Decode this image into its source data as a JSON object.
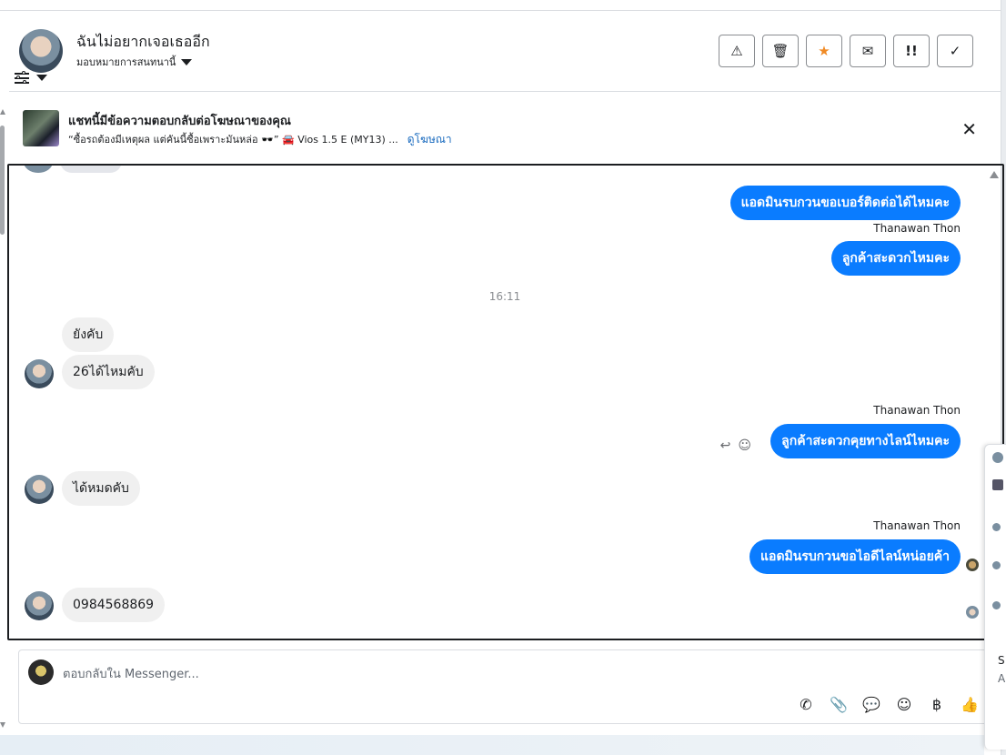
{
  "header": {
    "contact_name": "ฉันไม่อยากเจอเธออีก",
    "assign_label": "มอบหมายการสนทนานี้",
    "actions": [
      {
        "name": "report-spam-button",
        "icon": "warning-icon",
        "glyph": "⚠"
      },
      {
        "name": "delete-button",
        "icon": "trash-icon",
        "glyph": "🗑"
      },
      {
        "name": "star-button",
        "icon": "star-icon",
        "glyph": "★"
      },
      {
        "name": "mark-unread-button",
        "icon": "envelope-open-icon",
        "glyph": "✉"
      },
      {
        "name": "follow-up-button",
        "icon": "exclamation-icon",
        "glyph": "!!"
      },
      {
        "name": "mark-done-button",
        "icon": "check-icon",
        "glyph": "✓"
      }
    ]
  },
  "ad_banner": {
    "title": "แชทนี้มีข้อความตอบกลับต่อโฆษณาของคุณ",
    "subtitle": "“ซื้อรถต้องมีเหตุผล แต่คันนี้ซื้อเพราะมันหล่อ 🕶️” 🚘 Vios 1.5 E (MY13) ...",
    "link": "ดูโฆษณา",
    "close_glyph": "✕"
  },
  "messages": {
    "m1": "แอดมินรบกวนขอเบอร์ติดต่อได้ไหมคะ",
    "sender1": "Thanawan Thon",
    "m2": "ลูกค้าสะดวกไหมคะ",
    "time1": "16:11",
    "m3": "ยังคับ",
    "m4": "26ได้ไหมคับ",
    "sender2": "Thanawan Thon",
    "m5": "ลูกค้าสะดวกคุยทางไลน์ไหมคะ",
    "m6": "ได้หมดคับ",
    "sender3": "Thanawan Thon",
    "m7": "แอดมินรบกวนขอไอดีไลน์หน่อยค้า",
    "m8": "0984568869"
  },
  "composer": {
    "placeholder": "ตอบกลับใน Messenger...",
    "tools": [
      {
        "name": "call-add-icon",
        "glyph": "✆"
      },
      {
        "name": "attach-icon",
        "glyph": "📎"
      },
      {
        "name": "saved-reply-icon",
        "glyph": "💬"
      },
      {
        "name": "emoji-icon",
        "glyph": "☺"
      },
      {
        "name": "baht-icon",
        "glyph": "฿"
      },
      {
        "name": "like-icon",
        "glyph": "👍"
      }
    ]
  },
  "side_panel": {
    "text1": "S",
    "text2": "A"
  }
}
